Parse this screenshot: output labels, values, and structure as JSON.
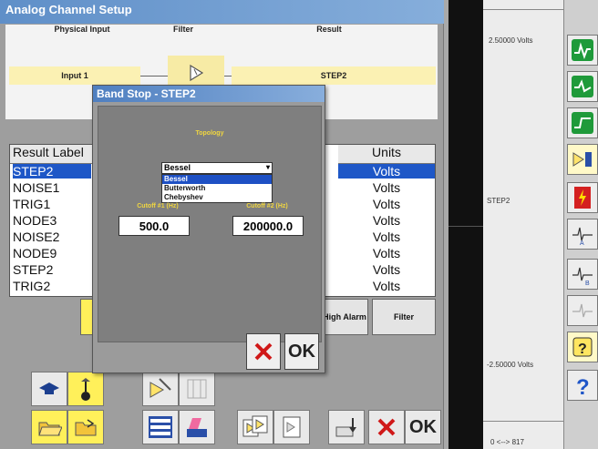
{
  "window": {
    "title": "Analog Channel Setup"
  },
  "flow": {
    "physical_input_head": "Physical Input",
    "filter_head": "Filter",
    "result_head": "Result",
    "input_name": "Input 1",
    "result_name": "STEP2"
  },
  "table": {
    "col_label": "Result Label",
    "col_units": "Units",
    "rows": [
      {
        "label": "STEP2",
        "units": "Volts"
      },
      {
        "label": "NOISE1",
        "units": "Volts"
      },
      {
        "label": "TRIG1",
        "units": "Volts"
      },
      {
        "label": "NODE3",
        "units": "Volts"
      },
      {
        "label": "NOISE2",
        "units": "Volts"
      },
      {
        "label": "NODE9",
        "units": "Volts"
      },
      {
        "label": "STEP2",
        "units": "Volts"
      },
      {
        "label": "TRIG2",
        "units": "Volts"
      }
    ],
    "selected_row": 0
  },
  "buttons": {
    "high_alarm": "High Alarm",
    "filter": "Filter",
    "ok": "OK"
  },
  "dialog": {
    "title": "Band Stop - STEP2",
    "topology_label": "Topology",
    "topology_selected": "Bessel",
    "topology_options": [
      "Bessel",
      "Butterworth",
      "Chebyshev"
    ],
    "cutoff1_label": "Cutoff #1 (Hz)",
    "cutoff1_value": "500.0",
    "cutoff2_label": "Cutoff #2 (Hz)",
    "cutoff2_value": "200000.0",
    "ok": "OK"
  },
  "scope": {
    "top_label": "2.50000 Volts",
    "mid_label": "STEP2",
    "bottom_label": "-2.50000 Volts",
    "footer": "0 <--> 817"
  }
}
